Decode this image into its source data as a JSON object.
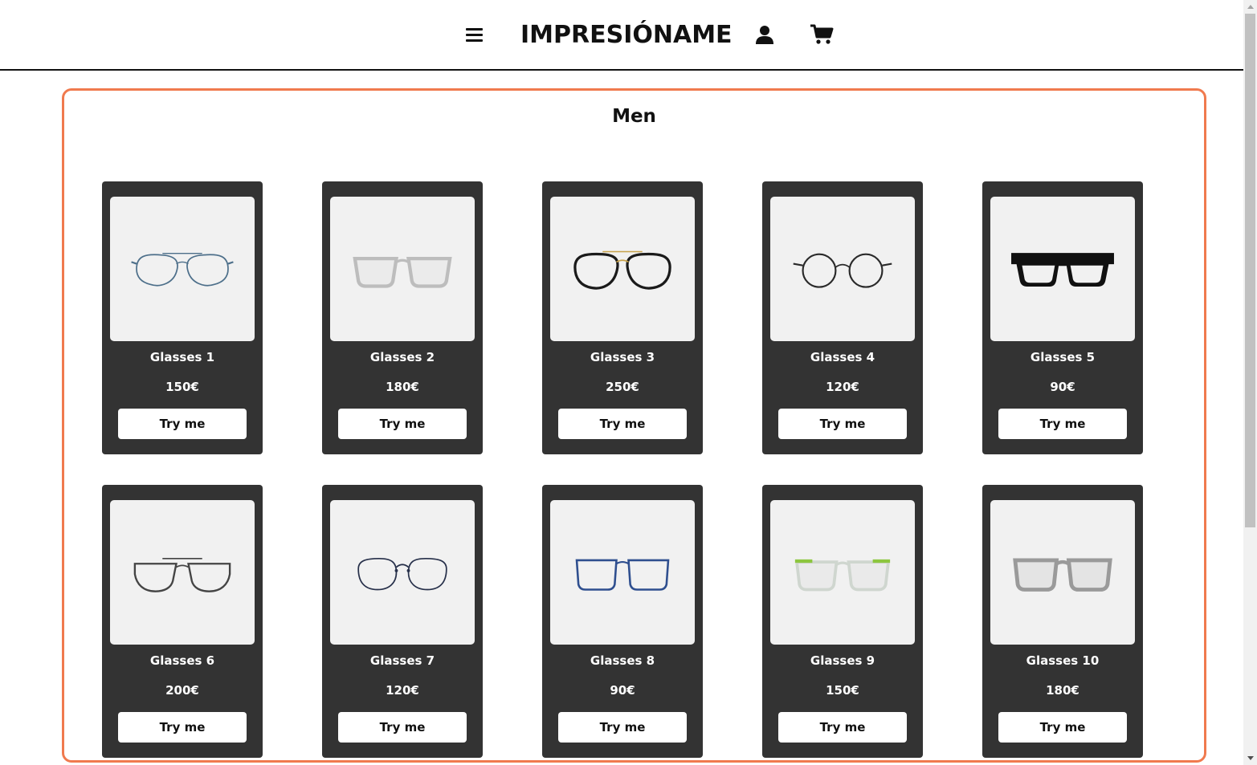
{
  "header": {
    "brand": "IMPRESIÓNAME",
    "menu_icon": "hamburger-menu-icon",
    "user_icon": "user-icon",
    "cart_icon": "shopping-cart-icon"
  },
  "section": {
    "title": "Men",
    "border_color": "#f07a4e",
    "card_color": "#333333"
  },
  "products": [
    {
      "name": "Glasses 1",
      "price": "150€",
      "button": "Try me",
      "frame_color": "#4d6f8a",
      "style": "aviator-thin"
    },
    {
      "name": "Glasses 2",
      "price": "180€",
      "button": "Try me",
      "frame_color": "#bdbdbd",
      "style": "square-clear"
    },
    {
      "name": "Glasses 3",
      "price": "250€",
      "button": "Try me",
      "frame_color": "#1a1a1a",
      "style": "aviator-bold"
    },
    {
      "name": "Glasses 4",
      "price": "120€",
      "button": "Try me",
      "frame_color": "#2a2a2a",
      "style": "round"
    },
    {
      "name": "Glasses 5",
      "price": "90€",
      "button": "Try me",
      "frame_color": "#111111",
      "style": "flat-top"
    },
    {
      "name": "Glasses 6",
      "price": "200€",
      "button": "Try me",
      "frame_color": "#444444",
      "style": "aviator-wide"
    },
    {
      "name": "Glasses 7",
      "price": "120€",
      "button": "Try me",
      "frame_color": "#27304a",
      "style": "round-thin"
    },
    {
      "name": "Glasses 8",
      "price": "90€",
      "button": "Try me",
      "frame_color": "#2f4f8f",
      "style": "square-thin"
    },
    {
      "name": "Glasses 9",
      "price": "150€",
      "button": "Try me",
      "frame_color": "#cfd6cf",
      "accent": "#8dc63f",
      "style": "square-clear-accent"
    },
    {
      "name": "Glasses 10",
      "price": "180€",
      "button": "Try me",
      "frame_color": "#9a9a9a",
      "style": "square-thick-grey"
    }
  ]
}
